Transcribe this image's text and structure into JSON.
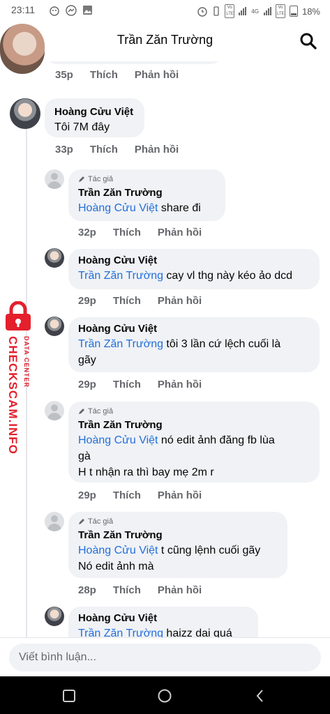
{
  "status_bar": {
    "time": "23:11",
    "network_badges": [
      "Vo LTE",
      "4G",
      "Vo LTE"
    ],
    "battery": "18%"
  },
  "header": {
    "title": "Trần Zăn Trường"
  },
  "comments": [
    {
      "time": "35p",
      "like": "Thích",
      "reply": "Phản hồi"
    },
    {
      "author": "Hoàng Cửu Việt",
      "text": "Tôi 7M đây",
      "time": "33p",
      "like": "Thích",
      "reply": "Phản hồi"
    },
    {
      "tag": "Tác giả",
      "author": "Trần Zăn Trường",
      "mention": "Hoàng Cửu Việt",
      "text": " share đi",
      "time": "32p",
      "like": "Thích",
      "reply": "Phản hồi"
    },
    {
      "author": "Hoàng Cửu Việt",
      "mention": "Trần Zăn Trường",
      "text": " cay vl thg này kéo ảo dcd",
      "time": "29p",
      "like": "Thích",
      "reply": "Phản hồi"
    },
    {
      "author": "Hoàng Cửu Việt",
      "mention": "Trần Zăn Trường",
      "text": " tôi 3 lần cứ lệch cuối là",
      "text2": "gãy",
      "time": "29p",
      "like": "Thích",
      "reply": "Phản hồi"
    },
    {
      "tag": "Tác giả",
      "author": "Trần Zăn Trường",
      "mention": "Hoàng Cửu Việt",
      "text": " nó edit ảnh đăng fb lùa",
      "text2": "gà",
      "text3": "H t nhận ra thì bay mẹ 2m r",
      "time": "29p",
      "like": "Thích",
      "reply": "Phản hồi"
    },
    {
      "tag": "Tác giả",
      "author": "Trần Zăn Trường",
      "mention": "Hoàng Cửu Việt",
      "text": " t cũng lệnh cuối gãy",
      "text2": "Nó edit ảnh mà",
      "time": "28p",
      "like": "Thích",
      "reply": "Phản hồi"
    },
    {
      "author": "Hoàng Cửu Việt",
      "mention": "Trần Zăn Trường",
      "text": " haizz dại quá"
    }
  ],
  "watermark": {
    "main": "CHECKSCAM.INFO",
    "sub": "DATA CENTER"
  },
  "composer": {
    "placeholder": "Viết bình luận..."
  },
  "colors": {
    "mention": "#216fdb",
    "bubble": "#f0f2f5",
    "meta": "#65676b",
    "watermark": "#e3202c"
  }
}
